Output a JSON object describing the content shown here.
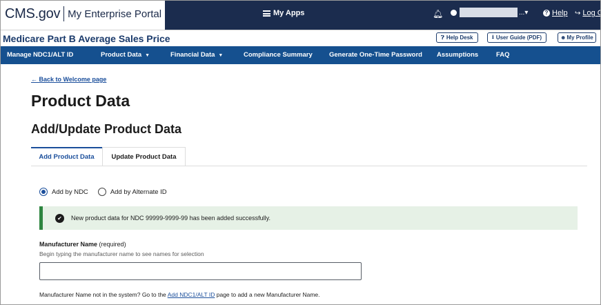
{
  "header": {
    "logo_main": "CMS.gov",
    "logo_sub": "My Enterprise Portal",
    "my_apps": "My Apps",
    "user_caret": "...▾",
    "help": "Help",
    "logout": "Log O"
  },
  "titlebar": {
    "app_title": "Medicare Part B Average Sales Price",
    "help_desk": "Help Desk",
    "user_guide": "User Guide (PDF)",
    "my_profile": "My Profile"
  },
  "nav": {
    "items": [
      {
        "label": "Manage NDC1/ALT ID",
        "has_caret": false
      },
      {
        "label": "Product Data",
        "has_caret": true
      },
      {
        "label": "Financial Data",
        "has_caret": true
      },
      {
        "label": "Compliance Summary",
        "has_caret": false
      },
      {
        "label": "Generate One-Time Password",
        "has_caret": false
      },
      {
        "label": "Assumptions",
        "has_caret": false
      },
      {
        "label": "FAQ",
        "has_caret": false
      }
    ]
  },
  "content": {
    "back_link": "← Back to Welcome page",
    "page_title": "Product Data",
    "section_title": "Add/Update Product Data",
    "tabs": [
      {
        "label": "Add Product Data",
        "active": true
      },
      {
        "label": "Update Product Data",
        "active": false
      }
    ],
    "radio_options": [
      {
        "label": "Add by NDC",
        "checked": true
      },
      {
        "label": "Add by Alternate ID",
        "checked": false
      }
    ],
    "alert_message": "New product data for NDC 99999-9999-99 has been added successfully.",
    "field_label": "Manufacturer Name",
    "field_required": "(required)",
    "field_hint": "Begin typing the manufacturer name to see names for selection",
    "field_value": "",
    "note_before": "Manufacturer Name not in the system? Go to the",
    "note_link": "Add NDC1/ALT ID",
    "note_after": "page to add a new Manufacturer Name."
  },
  "colors": {
    "top_bar": "#1b2c4e",
    "nav_bar": "#15508f",
    "accent": "#1a4e9b",
    "success_border": "#2e8540",
    "success_bg": "#e6f1e6"
  }
}
